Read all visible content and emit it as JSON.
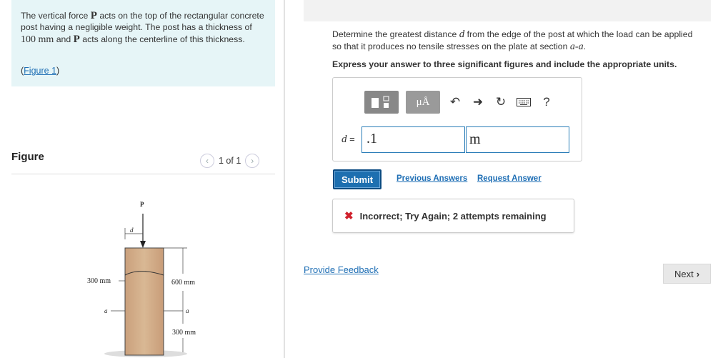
{
  "problem": {
    "text_1": "The vertical force ",
    "symbol_P": "P",
    "text_2": " acts on the top of the rectangular concrete post having a negligible weight. The post has a thickness of ",
    "thickness_value": "100 mm",
    "text_3": " and ",
    "text_4": " acts along the centerline of this thickness.",
    "figure_link_open": "(",
    "figure_link": "Figure 1",
    "figure_link_close": ")"
  },
  "figure_panel": {
    "heading": "Figure",
    "pager_text": "1 of 1",
    "prev_icon": "chevron-left-icon",
    "next_icon": "chevron-right-icon",
    "labels": {
      "force": "P",
      "distance": "d",
      "width": "300 mm",
      "top_height": "600 mm",
      "section": "a",
      "bottom_height": "300 mm"
    }
  },
  "question": {
    "text_1": "Determine the greatest distance ",
    "symbol_d": "d",
    "text_2": " from the edge of the post at which the load can be applied so that it produces no tensile stresses on the plate at section ",
    "section": "a-a",
    "text_3": ".",
    "instruction": "Express your answer to three significant figures and include the appropriate units."
  },
  "toolbar": {
    "units_label": "μÅ",
    "icons": [
      "templates-icon",
      "units-icon",
      "undo-icon",
      "redo-icon",
      "reset-icon",
      "keyboard-icon",
      "help-icon"
    ],
    "help_label": "?"
  },
  "answer": {
    "variable": "d",
    "equals": " =",
    "value": ".1",
    "unit": "m"
  },
  "actions": {
    "submit": "Submit",
    "previous_answers": "Previous Answers",
    "request_answer": "Request Answer"
  },
  "feedback": {
    "icon": "x-icon",
    "message": "Incorrect; Try Again; 2 attempts remaining",
    "color": "#d0202c"
  },
  "footer": {
    "provide_feedback": "Provide Feedback",
    "next": "Next"
  }
}
